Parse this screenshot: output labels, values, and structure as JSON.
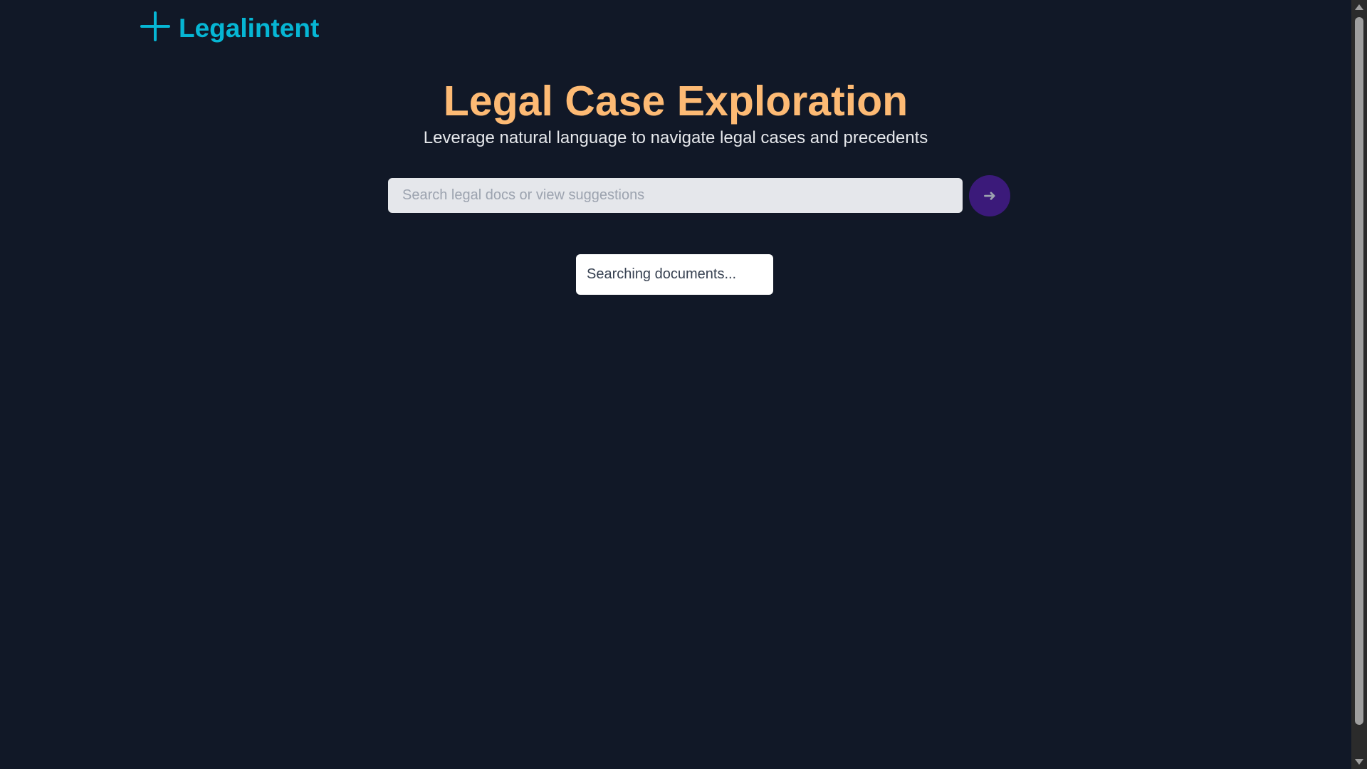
{
  "brand": {
    "name": "Legalintent",
    "icon": "plus-sparkle-icon"
  },
  "hero": {
    "title": "Legal Case Exploration",
    "subtitle": "Leverage natural language to navigate legal cases and precedents"
  },
  "search": {
    "value": "",
    "placeholder": "Search legal docs or view suggestions",
    "submit_icon": "arrow-right-icon"
  },
  "status": {
    "text": "Searching documents..."
  },
  "colors": {
    "background": "#111827",
    "brand": "#06b6d4",
    "title": "#fdba74",
    "button": "#3b1a7a"
  }
}
